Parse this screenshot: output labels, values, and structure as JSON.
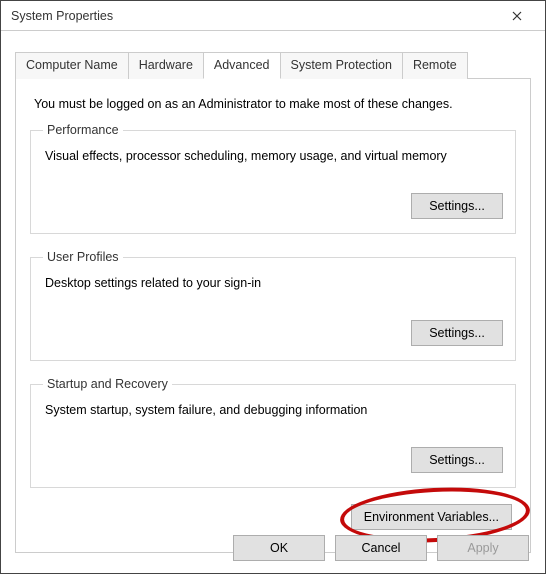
{
  "window": {
    "title": "System Properties"
  },
  "tabs": {
    "computer_name": "Computer Name",
    "hardware": "Hardware",
    "advanced": "Advanced",
    "system_protection": "System Protection",
    "remote": "Remote"
  },
  "advanced": {
    "intro": "You must be logged on as an Administrator to make most of these changes.",
    "performance": {
      "legend": "Performance",
      "desc": "Visual effects, processor scheduling, memory usage, and virtual memory",
      "button": "Settings..."
    },
    "user_profiles": {
      "legend": "User Profiles",
      "desc": "Desktop settings related to your sign-in",
      "button": "Settings..."
    },
    "startup": {
      "legend": "Startup and Recovery",
      "desc": "System startup, system failure, and debugging information",
      "button": "Settings..."
    },
    "env_button": "Environment Variables..."
  },
  "footer": {
    "ok": "OK",
    "cancel": "Cancel",
    "apply": "Apply"
  }
}
